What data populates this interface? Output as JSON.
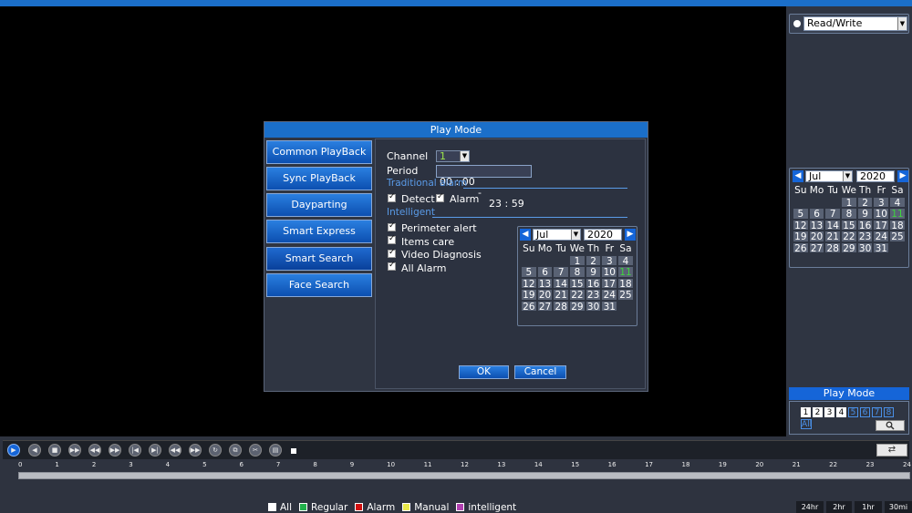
{
  "right_panel": {
    "mode_select": "Read/Write",
    "calendar": {
      "month": "Jul",
      "year": "2020",
      "weekdays": [
        "Su",
        "Mo",
        "Tu",
        "We",
        "Th",
        "Fr",
        "Sa"
      ],
      "days": [
        "",
        "",
        "",
        "1",
        "2",
        "3",
        "4",
        "5",
        "6",
        "7",
        "8",
        "9",
        "10",
        "11",
        "12",
        "13",
        "14",
        "15",
        "16",
        "17",
        "18",
        "19",
        "20",
        "21",
        "22",
        "23",
        "24",
        "25",
        "26",
        "27",
        "28",
        "29",
        "30",
        "31"
      ],
      "today": "11"
    },
    "play_mode_button": "Play Mode",
    "channels": [
      "1",
      "2",
      "3",
      "4",
      "5",
      "6",
      "7",
      "8"
    ],
    "all_label": "All",
    "search_icon": "search-icon"
  },
  "dialog": {
    "title": "Play Mode",
    "menu": [
      "Common PlayBack",
      "Sync PlayBack",
      "Dayparting",
      "Smart Express",
      "Smart Search",
      "Face Search"
    ],
    "channel_label": "Channel",
    "channel_value": "1",
    "period_label": "Period",
    "period_start": "00 : 00",
    "period_sep": "-",
    "period_end": "23 : 59",
    "traditional_alarm_label": "Traditional alarm",
    "detect_label": "Detect",
    "alarm_label": "Alarm",
    "intelligent_label": "Intelligent",
    "intelligent_items": [
      "Perimeter alert",
      "Items care",
      "Video Diagnosis",
      "All Alarm"
    ],
    "calendar": {
      "month": "Jul",
      "year": "2020",
      "today": "11"
    },
    "ok": "OK",
    "cancel": "Cancel"
  },
  "timeline": {
    "hours": [
      "0",
      "1",
      "2",
      "3",
      "4",
      "5",
      "6",
      "7",
      "8",
      "9",
      "10",
      "11",
      "12",
      "13",
      "14",
      "15",
      "16",
      "17",
      "18",
      "19",
      "20",
      "21",
      "22",
      "23",
      "24"
    ]
  },
  "legend": {
    "items": [
      {
        "label": "All",
        "color": "#ffffff"
      },
      {
        "label": "Regular",
        "color": "#22b14c"
      },
      {
        "label": "Alarm",
        "color": "#d01010"
      },
      {
        "label": "Manual",
        "color": "#e8e84a"
      },
      {
        "label": "intelligent",
        "color": "#b040b0"
      }
    ]
  },
  "time_scale": [
    "24hr",
    "2hr",
    "1hr",
    "30mi"
  ],
  "colors": {
    "accent": "#1b6fc9",
    "button": "#1565d8",
    "today": "#3fd23f"
  }
}
